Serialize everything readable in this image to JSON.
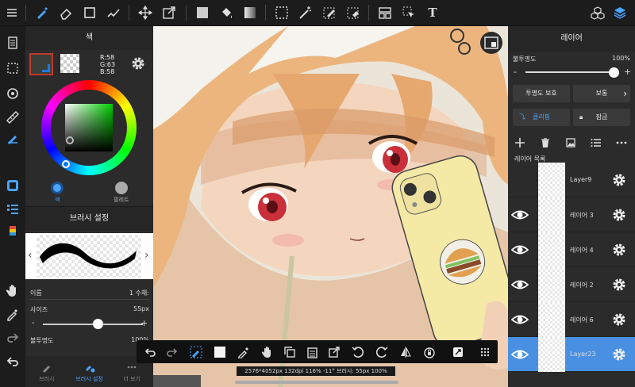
{
  "colors": {
    "accent": "#4a90e2",
    "panel": "#2b2b2b",
    "toolbar": "#1c1c1c",
    "selected_swatch_border": "#c0392b"
  },
  "top_toolbar": {
    "icons": [
      "menu-icon",
      "brush-icon",
      "eraser-icon",
      "select-rect-icon",
      "auto-select-icon",
      "move-icon",
      "transform-icon",
      "fill-color-icon",
      "bucket-icon",
      "gradient-icon",
      "marquee-icon",
      "magic-wand-icon",
      "select-pen-icon",
      "select-eraser-icon",
      "panel-layout-icon",
      "select-arrow-icon",
      "text-icon",
      "materials-icon",
      "layers-icon"
    ],
    "text_tool_label": "T"
  },
  "color_panel": {
    "title": "색",
    "rgb": {
      "r": "R:58",
      "g": "G:63",
      "b": "B:58"
    },
    "primary_color": "#3a3f3a",
    "tabs": [
      "색",
      "팔레트"
    ]
  },
  "brush_panel": {
    "title": "브러시 설정",
    "name_label": "이름",
    "name_value": "1 수채:",
    "size_label": "사이즈",
    "size_value": "55px",
    "size_fraction": 0.55,
    "opacity_label": "불투명도",
    "opacity_value": "100%",
    "tabs": [
      "브러시",
      "브러시 설정",
      "더 보기"
    ],
    "active_tab": 1
  },
  "status": {
    "text": "2576*4052px 132dpi 116% -11° 브러시: 55px 100%"
  },
  "layer_panel": {
    "title": "레이어",
    "opacity_label": "불투명도",
    "opacity_value": "100%",
    "opacity_fraction": 1.0,
    "minus": "-",
    "plus": "+",
    "protect_alpha": "투명도 보호",
    "blend_mode": "보통",
    "clipping": "클리핑",
    "lock": "잠금",
    "list_label": "레이어 목록",
    "layers": [
      {
        "name": "Layer9",
        "visible": false,
        "selected": false
      },
      {
        "name": "레이어 3",
        "visible": true,
        "selected": false
      },
      {
        "name": "레이어 4",
        "visible": true,
        "selected": false
      },
      {
        "name": "레이어 2",
        "visible": true,
        "selected": false
      },
      {
        "name": "레이어 6",
        "visible": true,
        "selected": false
      },
      {
        "name": "Layer23",
        "visible": true,
        "selected": true
      }
    ]
  },
  "floating_toolbar": {
    "icons": [
      "undo-icon",
      "redo-icon",
      "brush-select-icon",
      "color-swatch-icon",
      "eyedropper-icon",
      "hand-icon",
      "copy-icon",
      "paste-icon",
      "export-icon",
      "rotate-left-icon",
      "rotate-right-icon",
      "flip-icon",
      "lock-icon",
      "fullscreen-icon",
      "grid-icon"
    ]
  }
}
